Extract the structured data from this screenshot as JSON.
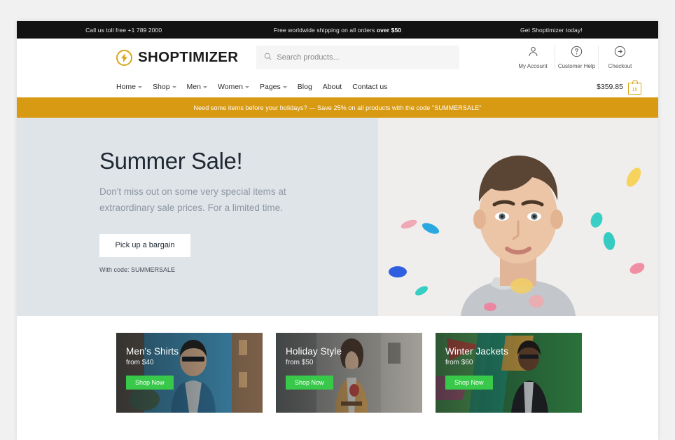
{
  "topbar": {
    "items": [
      {
        "text": "Call us toll free +1 789 2000"
      },
      {
        "text": "Free worldwide shipping on all orders ",
        "strong": "over $50"
      },
      {
        "text": "Get Shoptimizer today!"
      }
    ]
  },
  "header": {
    "brand": "SHOPTIMIZER",
    "logo_icon": "lightning-bolt-icon",
    "search": {
      "placeholder": "Search products...",
      "value": "",
      "icon": "search-icon"
    },
    "actions": [
      {
        "label": "My Account",
        "icon": "user-icon"
      },
      {
        "label": "Customer Help",
        "icon": "question-circle-icon"
      },
      {
        "label": "Checkout",
        "icon": "arrow-right-circle-icon"
      }
    ]
  },
  "nav": {
    "items": [
      {
        "label": "Home",
        "dropdown": true
      },
      {
        "label": "Shop",
        "dropdown": true
      },
      {
        "label": "Men",
        "dropdown": true
      },
      {
        "label": "Women",
        "dropdown": true
      },
      {
        "label": "Pages",
        "dropdown": true
      },
      {
        "label": "Blog",
        "dropdown": false
      },
      {
        "label": "About",
        "dropdown": false
      },
      {
        "label": "Contact us",
        "dropdown": false
      }
    ],
    "cart": {
      "total": "$359.85",
      "count": "15",
      "icon": "shopping-bag-icon"
    }
  },
  "promo": {
    "text": "Need some items before your holidays? — Save 25% on all products with the code \"SUMMERSALE\""
  },
  "hero": {
    "title": "Summer Sale!",
    "subtitle": "Don't miss out on some very special items at extraordinary sale prices. For a limited time.",
    "button": "Pick up a bargain",
    "code_note": "With code: SUMMERSALE",
    "image_alt": "young man with colorful confetti on white background"
  },
  "cards": [
    {
      "title": "Men's Shirts",
      "price": "from $40",
      "button": "Shop Now",
      "image_alt": "man in denim vest and sunglasses in alley"
    },
    {
      "title": "Holiday Style",
      "price": "from $50",
      "button": "Shop Now",
      "image_alt": "woman in tan leather jacket on street"
    },
    {
      "title": "Winter Jackets",
      "price": "from $60",
      "button": "Shop Now",
      "image_alt": "man in black leather jacket by graffiti wall"
    }
  ],
  "colors": {
    "topbar_bg": "#121212",
    "promo_bg": "#d89a13",
    "hero_bg": "#dfe4e9",
    "brand_gold": "#d8a71c",
    "shop_now_green": "#39c94a",
    "page_bg": "#f2f1f1"
  }
}
